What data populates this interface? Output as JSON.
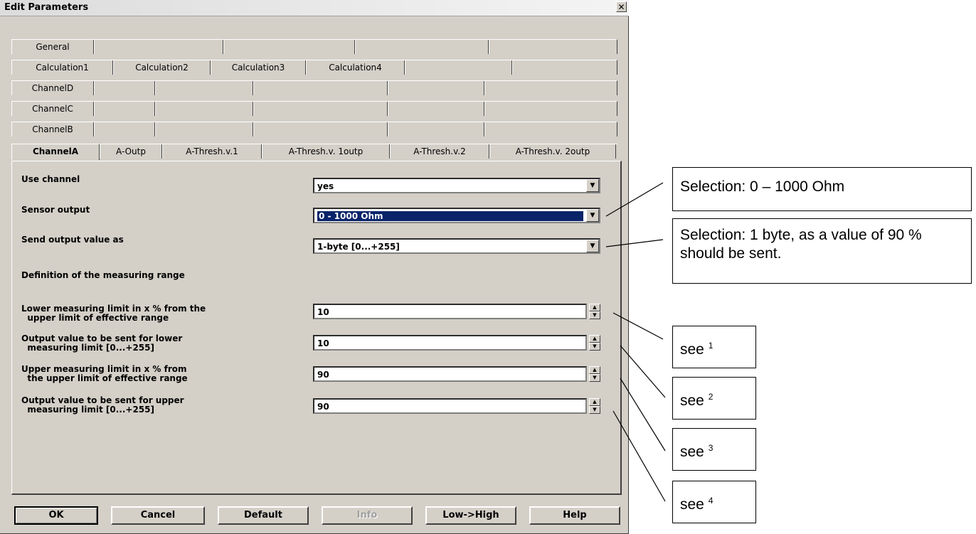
{
  "window": {
    "title": "Edit Parameters",
    "close": "✕"
  },
  "tabs": {
    "row1": [
      "General",
      "",
      "",
      "",
      ""
    ],
    "row2": [
      "Calculation1",
      "Calculation2",
      "Calculation3",
      "Calculation4",
      "",
      ""
    ],
    "row3": [
      "ChannelD",
      "",
      "",
      "",
      "",
      ""
    ],
    "row4": [
      "ChannelC",
      "",
      "",
      "",
      "",
      ""
    ],
    "row5": [
      "ChannelB",
      "",
      "",
      "",
      "",
      ""
    ],
    "row6": [
      "ChannelA",
      "A-Outp",
      "A-Thresh.v.1",
      "A-Thresh.v. 1outp",
      "A-Thresh.v.2",
      "A-Thresh.v. 2outp"
    ]
  },
  "params": {
    "use_channel": {
      "label": "Use channel",
      "value": "yes"
    },
    "sensor_output": {
      "label": "Sensor output",
      "value": "0 - 1000 Ohm"
    },
    "send_output": {
      "label": "Send output value as",
      "value": "1-byte [0...+255]"
    },
    "definition": {
      "label": "Definition of the measuring range"
    },
    "lower_limit": {
      "label": "Lower measuring limit in x % from the\n  upper limit of effective range",
      "value": "10"
    },
    "lower_output": {
      "label": "Output value to be sent for lower\n  measuring limit [0...+255]",
      "value": "10"
    },
    "upper_limit": {
      "label": "Upper measuring limit in x % from\n  the upper limit of effective range",
      "value": "90"
    },
    "upper_output": {
      "label": "Output value to be sent for upper\n  measuring limit [0...+255]",
      "value": "90"
    }
  },
  "buttons": {
    "ok": "OK",
    "cancel": "Cancel",
    "default": "Default",
    "info": "Info",
    "lowhigh": "Low->High",
    "help": "Help"
  },
  "callouts": {
    "c1": "Selection: 0 – 1000 Ohm",
    "c2": "Selection: 1 byte, as a value of 90 % should be sent.",
    "see": "see",
    "n1": "1",
    "n2": "2",
    "n3": "3",
    "n4": "4"
  }
}
